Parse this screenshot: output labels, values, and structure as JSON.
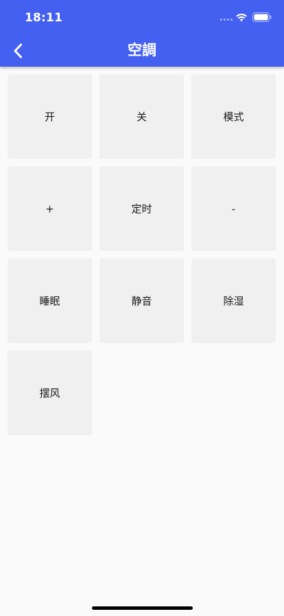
{
  "status": {
    "time": "18:11"
  },
  "header": {
    "title": "空調",
    "back_icon": "chevron-left-icon"
  },
  "colors": {
    "app_bar": "#4460f1",
    "tile": "#f0f0f0",
    "background": "#fafafa"
  },
  "buttons": [
    {
      "label": "开",
      "name": "power-on-button"
    },
    {
      "label": "关",
      "name": "power-off-button"
    },
    {
      "label": "模式",
      "name": "mode-button"
    },
    {
      "label": "+",
      "name": "temperature-up-button"
    },
    {
      "label": "定时",
      "name": "timer-button"
    },
    {
      "label": "-",
      "name": "temperature-down-button"
    },
    {
      "label": "睡眠",
      "name": "sleep-button"
    },
    {
      "label": "静音",
      "name": "mute-button"
    },
    {
      "label": "除湿",
      "name": "dehumidify-button"
    },
    {
      "label": "摆风",
      "name": "swing-button"
    }
  ]
}
